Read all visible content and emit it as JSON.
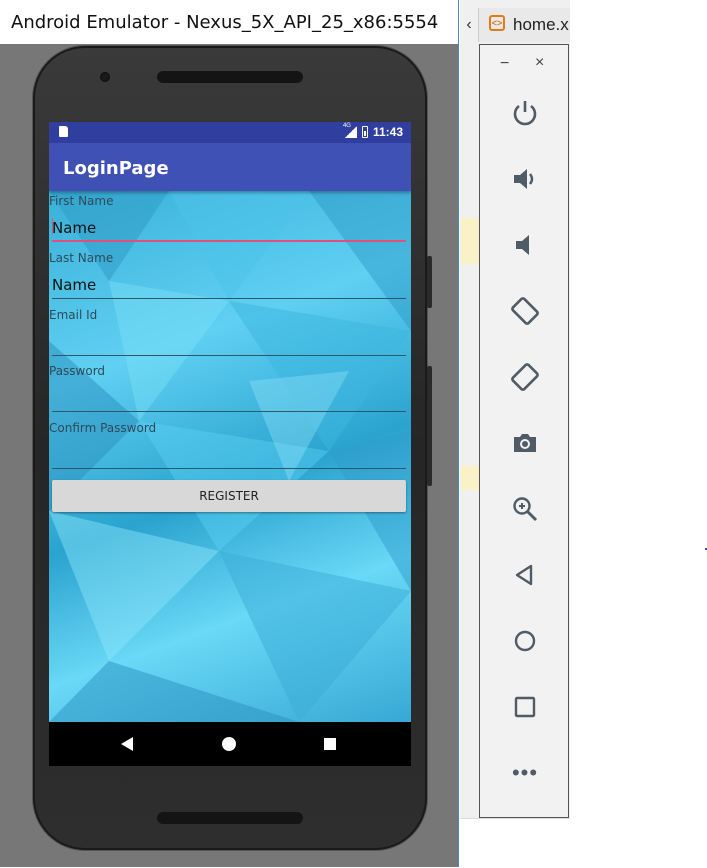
{
  "window": {
    "title": "Android Emulator - Nexus_5X_API_25_x86:5554"
  },
  "status_bar": {
    "network": "4G",
    "time": "11:43"
  },
  "app_bar": {
    "title": "LoginPage"
  },
  "form": {
    "first_name": {
      "label": "First Name",
      "value": "Name"
    },
    "last_name": {
      "label": "Last Name",
      "value": "Name"
    },
    "email": {
      "label": "Email Id",
      "value": ""
    },
    "password": {
      "label": "Password",
      "value": ""
    },
    "confirm_password": {
      "label": "Confirm Password",
      "value": ""
    },
    "register_label": "REGISTER"
  },
  "background_ide": {
    "tab_label": "home.x",
    "tab_icon": "xml-file-icon"
  },
  "toolbar": {
    "minimize": "−",
    "close": "×",
    "more": "•••",
    "icons": [
      "power-icon",
      "volume-up-icon",
      "volume-down-icon",
      "rotate-left-icon",
      "rotate-right-icon",
      "camera-icon",
      "zoom-icon",
      "back-icon",
      "home-icon",
      "overview-icon",
      "more-icon"
    ],
    "icon_color": "#4f5b66"
  },
  "colors": {
    "status_bar": "#303f9f",
    "app_bar": "#3f51b5",
    "accent": "#e14f7a"
  }
}
